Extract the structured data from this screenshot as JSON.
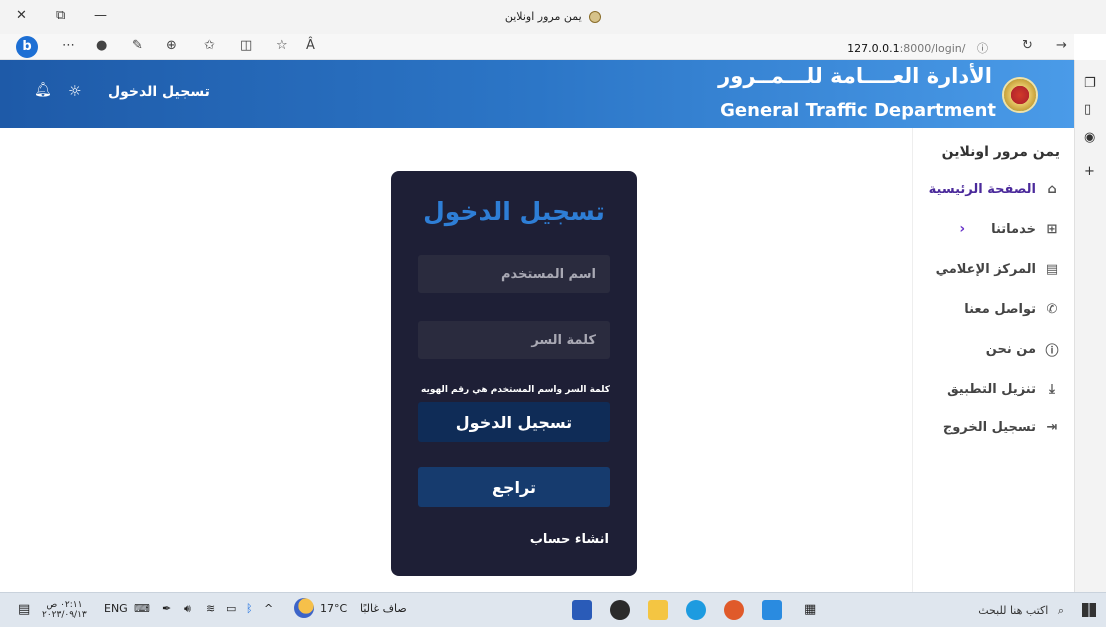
{
  "browser": {
    "tab_title": "يمن مرور اونلاين",
    "url_host": "127.0.0.1",
    "url_path": ":8000/login/",
    "read_aloud": "Â"
  },
  "header": {
    "login_label": "تسجيل الدخول",
    "title_ar": "الأدارة العــــامة للـــمــرور",
    "title_en": "General Traffic Department"
  },
  "nav": {
    "site_title": "يمن مرور اونلاين",
    "items": [
      {
        "label": "الصفحة الرئيسية",
        "icon": "⌂"
      },
      {
        "label": "خدماتنا",
        "icon": "⊞"
      },
      {
        "label": "المركز الإعلامي",
        "icon": "▤"
      },
      {
        "label": "تواصل معنا",
        "icon": "✆"
      },
      {
        "label": "من نحن",
        "icon": "ⓘ"
      },
      {
        "label": "تنزيل التطبيق",
        "icon": "⤓"
      },
      {
        "label": "تسجيل الخروج",
        "icon": "⇥"
      }
    ]
  },
  "login": {
    "title": "تسجيل الدخول",
    "username_placeholder": "اسم المستخدم",
    "password_placeholder": "كلمة السر",
    "hint": "كلمة السر واسم المستخدم هي رقم الهويه",
    "submit_label": "تسجيل الدخول",
    "back_label": "تراجع",
    "create_account": "انشاء حساب"
  },
  "taskbar": {
    "search_placeholder": "اكتب هنا للبحث",
    "weather": "صاف غالبًا",
    "temperature": "17°C",
    "language": "ENG",
    "time": "٠٢:١١ ص",
    "date": "٢٠٢٣/٠٩/١٣"
  },
  "colors": {
    "header_start": "#1e5aa8",
    "header_end": "#4a9be8",
    "card_bg": "#1e1f36",
    "accent_title": "#2e7ed6",
    "button_bg": "#0f2c57"
  }
}
